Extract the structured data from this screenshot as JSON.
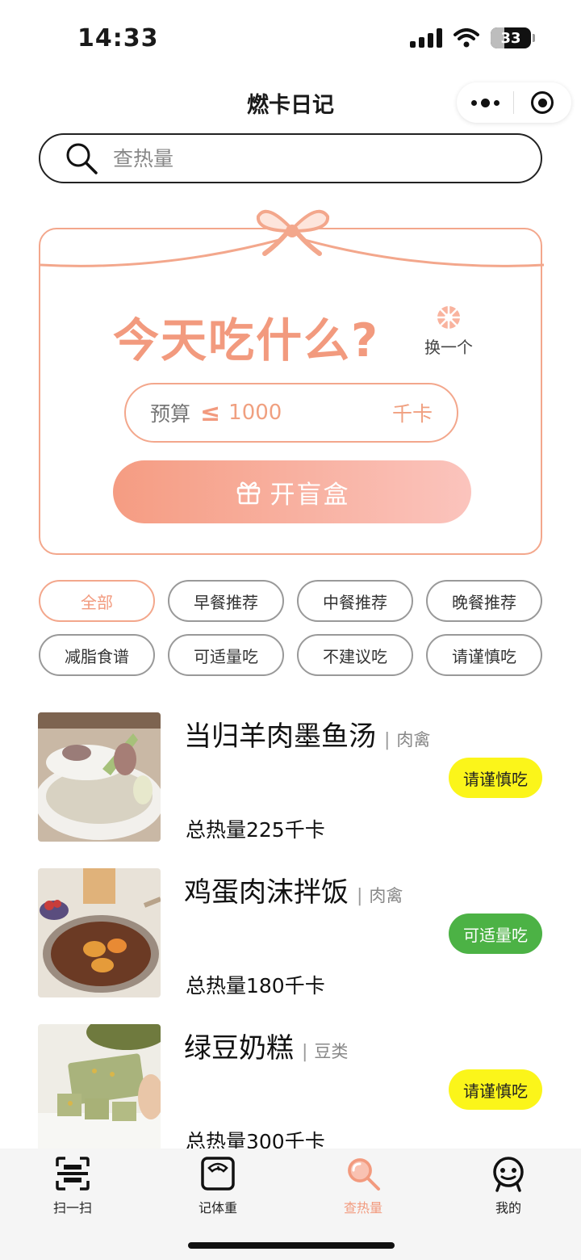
{
  "status_bar": {
    "time": "14:33",
    "battery": "33",
    "battery_level": 0.33
  },
  "app": {
    "title": "燃卡日记"
  },
  "search": {
    "placeholder": "查热量"
  },
  "gift_box": {
    "title": "今天吃什么?",
    "swap_label": "换一个",
    "budget_label": "预算",
    "budget_sign": "≤",
    "budget_value": "1000",
    "budget_unit": "千卡",
    "open_button": "开盲盒"
  },
  "filters": [
    {
      "label": "全部",
      "active": true
    },
    {
      "label": "早餐推荐"
    },
    {
      "label": "中餐推荐"
    },
    {
      "label": "晚餐推荐"
    },
    {
      "label": "减脂食谱"
    },
    {
      "label": "可适量吃"
    },
    {
      "label": "不建议吃"
    },
    {
      "label": "请谨慎吃"
    }
  ],
  "foods": [
    {
      "name": "当归羊肉墨鱼汤",
      "category": "肉禽",
      "badge": "请谨慎吃",
      "badge_color": "#fbf51a",
      "calories": "总热量225千卡"
    },
    {
      "name": "鸡蛋肉沫拌饭",
      "category": "肉禽",
      "badge": "可适量吃",
      "badge_color": "#4cb245",
      "calories": "总热量180千卡"
    },
    {
      "name": "绿豆奶糕",
      "category": "豆类",
      "badge": "请谨慎吃",
      "badge_color": "#fbf51a",
      "calories": "总热量300千卡"
    }
  ],
  "separator": "|",
  "tabs": [
    {
      "label": "扫一扫",
      "icon": "scan-icon"
    },
    {
      "label": "记体重",
      "icon": "scale-icon"
    },
    {
      "label": "查热量",
      "icon": "search-icon",
      "active": true
    },
    {
      "label": "我的",
      "icon": "profile-icon"
    }
  ],
  "colors": {
    "accent": "#f29a7e",
    "caution": "#fbf51a",
    "moderate": "#4cb245"
  }
}
